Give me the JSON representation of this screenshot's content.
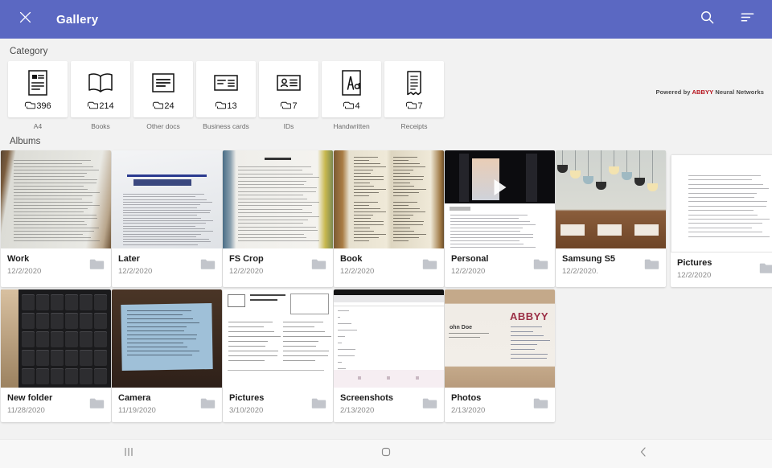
{
  "appbar": {
    "close_icon": "close-icon",
    "title": "Gallery",
    "search_icon": "search-icon",
    "sort_icon": "sort-icon"
  },
  "branding": {
    "prefix": "Powered by",
    "brand": "ABBYY",
    "suffix": "Neural Networks"
  },
  "category": {
    "label": "Category",
    "items": [
      {
        "name": "A4",
        "count": "396",
        "icon": "document-portrait-icon"
      },
      {
        "name": "Books",
        "count": "214",
        "icon": "open-book-icon"
      },
      {
        "name": "Other docs",
        "count": "24",
        "icon": "document-landscape-icon"
      },
      {
        "name": "Business cards",
        "count": "13",
        "icon": "business-card-icon"
      },
      {
        "name": "IDs",
        "count": "7",
        "icon": "id-card-icon"
      },
      {
        "name": "Handwritten",
        "count": "4",
        "icon": "handwriting-icon"
      },
      {
        "name": "Receipts",
        "count": "7",
        "icon": "receipt-icon"
      }
    ]
  },
  "albums": {
    "label": "Albums",
    "rows": [
      [
        {
          "title": "Work",
          "date": "12/2/2020",
          "thumb": "document-page-photo",
          "video": false
        },
        {
          "title": "Later",
          "date": "12/2/2020",
          "thumb": "insurance-letter",
          "video": false
        },
        {
          "title": "FS Crop",
          "date": "12/2/2020",
          "thumb": "cropped-document",
          "video": false
        },
        {
          "title": "Book",
          "date": "12/2/2020",
          "thumb": "open-book-photo",
          "video": false
        },
        {
          "title": "Personal",
          "date": "12/2/2020",
          "thumb": "social-video-post",
          "video": true
        },
        {
          "title": "Samsung S5",
          "date": "12/2/2020.",
          "thumb": "cafe-lamps-photo",
          "video": false
        },
        {
          "title": "Pictures",
          "date": "12/2/2020",
          "thumb": "text-page-scan",
          "video": false
        }
      ],
      [
        {
          "title": "New folder",
          "date": "11/28/2020",
          "thumb": "keyboard-photo",
          "video": false
        },
        {
          "title": "Camera",
          "date": "11/19/2020",
          "thumb": "blue-note-photo",
          "video": false
        },
        {
          "title": "Pictures",
          "date": "3/10/2020",
          "thumb": "form-scan",
          "video": false
        },
        {
          "title": "Screenshots",
          "date": "2/13/2020",
          "thumb": "app-screenshot",
          "video": false
        },
        {
          "title": "Photos",
          "date": "2/13/2020",
          "thumb": "abbyy-business-card",
          "video": false
        }
      ]
    ],
    "folder_icon": "folder-icon"
  },
  "navbar": {
    "recents_icon": "recent-apps-icon",
    "home_icon": "home-icon",
    "back_icon": "back-icon"
  },
  "colors": {
    "appbar": "#5b68c2",
    "background": "#f2f2f2",
    "card": "#ffffff",
    "brand_red": "#b5121b",
    "muted_text": "#8a8a8a"
  }
}
